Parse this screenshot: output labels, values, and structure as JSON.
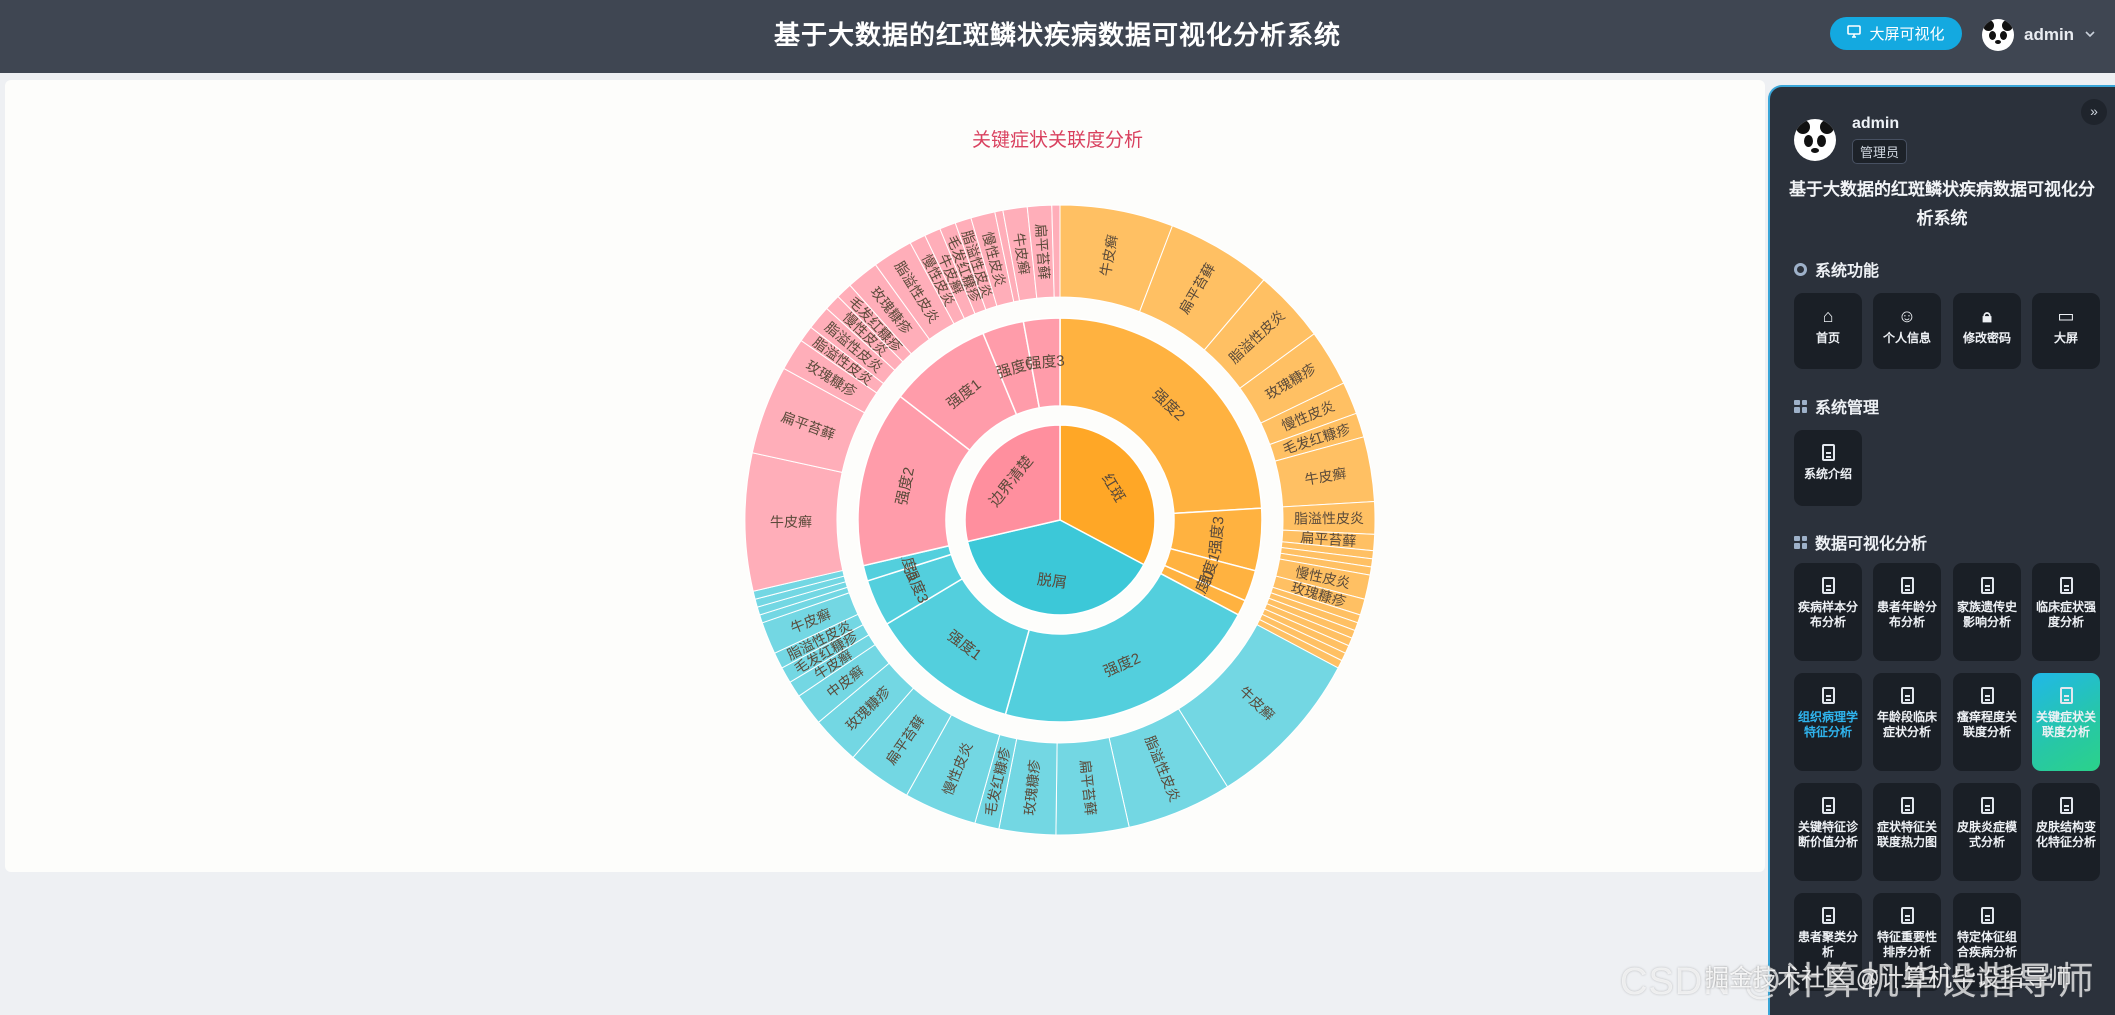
{
  "header": {
    "title": "基于大数据的红斑鳞状疾病数据可视化分析系统",
    "big_screen_button": "大屏可视化",
    "username": "admin"
  },
  "chart_title": "关键症状关联度分析",
  "panel": {
    "username": "admin",
    "role": "管理员",
    "system_title": "基于大数据的红斑鳞状疾病数据可视化分析系统",
    "sections": {
      "system_functions": "系统功能",
      "system_management": "系统管理",
      "data_visualization": "数据可视化分析"
    },
    "function_tiles": [
      {
        "label": "首页",
        "icon": "home-icon"
      },
      {
        "label": "个人信息",
        "icon": "user-icon"
      },
      {
        "label": "修改密码",
        "icon": "lock-icon"
      },
      {
        "label": "大屏",
        "icon": "presentation-icon"
      }
    ],
    "management_tiles": [
      {
        "label": "系统介绍",
        "icon": "document-icon"
      }
    ],
    "analysis_tiles": [
      {
        "label": "疾病样本分布分析",
        "icon": "document-icon",
        "active": false
      },
      {
        "label": "患者年龄分布分析",
        "icon": "document-icon",
        "active": false
      },
      {
        "label": "家族遗传史影响分析",
        "icon": "document-icon",
        "active": false
      },
      {
        "label": "临床症状强度分析",
        "icon": "document-icon",
        "active": false
      },
      {
        "label": "组织病理学特征分析",
        "icon": "document-icon",
        "active": false,
        "highlight": true
      },
      {
        "label": "年龄段临床症状分析",
        "icon": "document-icon",
        "active": false
      },
      {
        "label": "瘙痒程度关联度分析",
        "icon": "document-icon",
        "active": false
      },
      {
        "label": "关键症状关联度分析",
        "icon": "document-icon",
        "active": true
      },
      {
        "label": "关键特征诊断价值分析",
        "icon": "document-icon",
        "active": false
      },
      {
        "label": "症状特征关联度热力图",
        "icon": "document-icon",
        "active": false
      },
      {
        "label": "皮肤炎症模式分析",
        "icon": "document-icon",
        "active": false
      },
      {
        "label": "皮肤结构变化特征分析",
        "icon": "document-icon",
        "active": false
      },
      {
        "label": "患者聚类分析",
        "icon": "document-icon",
        "active": false
      },
      {
        "label": "特征重要性排序分析",
        "icon": "document-icon",
        "active": false
      },
      {
        "label": "特定体征组合疾病分析",
        "icon": "document-icon",
        "active": false
      }
    ]
  },
  "watermark": "CSDN @计算机毕设指导师",
  "watermark2": "掘金技术社区 @计算机毕设指导师",
  "colors": {
    "red_spot": "#ffa726",
    "clear_border": "#ff8f9e",
    "scaling": "#3cc8d8"
  },
  "chart_data": {
    "type": "sunburst",
    "title": "关键症状关联度分析",
    "children": [
      {
        "name": "红斑",
        "color": "#ffa726",
        "children": [
          {
            "name": "强度2",
            "children": [
              {
                "name": "牛皮癣",
                "value": 14
              },
              {
                "name": "扁平苔藓",
                "value": 13
              },
              {
                "name": "脂溢性皮炎",
                "value": 9
              },
              {
                "name": "玫瑰糠疹",
                "value": 7
              },
              {
                "name": "慢性皮炎",
                "value": 4
              },
              {
                "name": "毛发红糠疹",
                "value": 3
              },
              {
                "name": "牛皮癣",
                "value": 8
              }
            ]
          },
          {
            "name": "强度3",
            "children": [
              {
                "name": "脂溢性皮炎",
                "value": 4
              },
              {
                "name": "扁平苔藓",
                "value": 2
              },
              {
                "name": "玫瑰糠疹",
                "value": 1
              },
              {
                "name": "毛发红糠疹",
                "value": 1
              },
              {
                "name": "慢性皮炎",
                "value": 1
              },
              {
                "name": "慢性皮炎",
                "value": 3
              }
            ]
          },
          {
            "name": "强度1",
            "children": [
              {
                "name": "玫瑰糠疹",
                "value": 2
              },
              {
                "name": "毛发红糠疹",
                "value": 1
              },
              {
                "name": "慢性皮炎",
                "value": 1
              },
              {
                "name": "牛皮癣",
                "value": 1
              },
              {
                "name": "扁平苔藓",
                "value": 1
              }
            ]
          },
          {
            "name": "强度0",
            "children": [
              {
                "name": "毛发红糠疹",
                "value": 1
              },
              {
                "name": "牛皮癣",
                "value": 1
              },
              {
                "name": "慢性皮炎",
                "value": 1
              }
            ]
          }
        ]
      },
      {
        "name": "脱屑",
        "color": "#3cc8d8",
        "children": [
          {
            "name": "强度2",
            "children": [
              {
                "name": "牛皮癣",
                "value": 20
              },
              {
                "name": "脂溢性皮炎",
                "value": 13
              },
              {
                "name": "扁平苔藓",
                "value": 9
              },
              {
                "name": "玫瑰糠疹",
                "value": 7
              },
              {
                "name": "毛发红糠疹",
                "value": 3
              }
            ]
          },
          {
            "name": "强度1",
            "children": [
              {
                "name": "慢性皮炎",
                "value": 9
              },
              {
                "name": "扁平苔藓",
                "value": 8
              },
              {
                "name": "玫瑰糠疹",
                "value": 6
              },
              {
                "name": "中皮癣",
                "value": 4
              },
              {
                "name": "牛皮癣",
                "value": 2
              }
            ]
          },
          {
            "name": "强度3",
            "children": [
              {
                "name": "毛发红糠疹",
                "value": 2
              },
              {
                "name": "脂溢性皮炎",
                "value": 2
              },
              {
                "name": "牛皮癣",
                "value": 4
              },
              {
                "name": "扁平苔藓",
                "value": 1
              }
            ]
          },
          {
            "name": "强度0",
            "children": [
              {
                "name": "玫瑰糠疹",
                "value": 1
              },
              {
                "name": "脂溢性皮炎",
                "value": 1
              },
              {
                "name": "慢性皮炎",
                "value": 1
              }
            ]
          }
        ]
      },
      {
        "name": "边界清楚",
        "color": "#ff8f9e",
        "children": [
          {
            "name": "强度2",
            "children": [
              {
                "name": "牛皮癣",
                "value": 17
              },
              {
                "name": "扁平苔藓",
                "value": 11
              },
              {
                "name": "玫瑰糠疹",
                "value": 4
              },
              {
                "name": "脂溢性皮炎",
                "value": 2
              }
            ]
          },
          {
            "name": "强度1",
            "children": [
              {
                "name": "脂溢性皮炎",
                "value": 3
              },
              {
                "name": "慢性皮炎",
                "value": 2
              },
              {
                "name": "毛发红糠疹",
                "value": 2
              },
              {
                "name": "玫瑰糠疹",
                "value": 4
              },
              {
                "name": "脂溢性皮炎",
                "value": 5
              },
              {
                "name": "慢性皮炎",
                "value": 2
              },
              {
                "name": "牛皮癣",
                "value": 2
              }
            ]
          },
          {
            "name": "强度0",
            "children": [
              {
                "name": "毛发红糠疹",
                "value": 2
              },
              {
                "name": "脂溢性皮炎",
                "value": 2
              },
              {
                "name": "慢性皮炎",
                "value": 3
              },
              {
                "name": "玫瑰糠疹",
                "value": 1
              }
            ]
          },
          {
            "name": "强度3",
            "children": [
              {
                "name": "牛皮癣",
                "value": 3
              },
              {
                "name": "扁平苔藓",
                "value": 3
              },
              {
                "name": "慢性皮炎",
                "value": 1
              }
            ]
          }
        ]
      }
    ]
  }
}
